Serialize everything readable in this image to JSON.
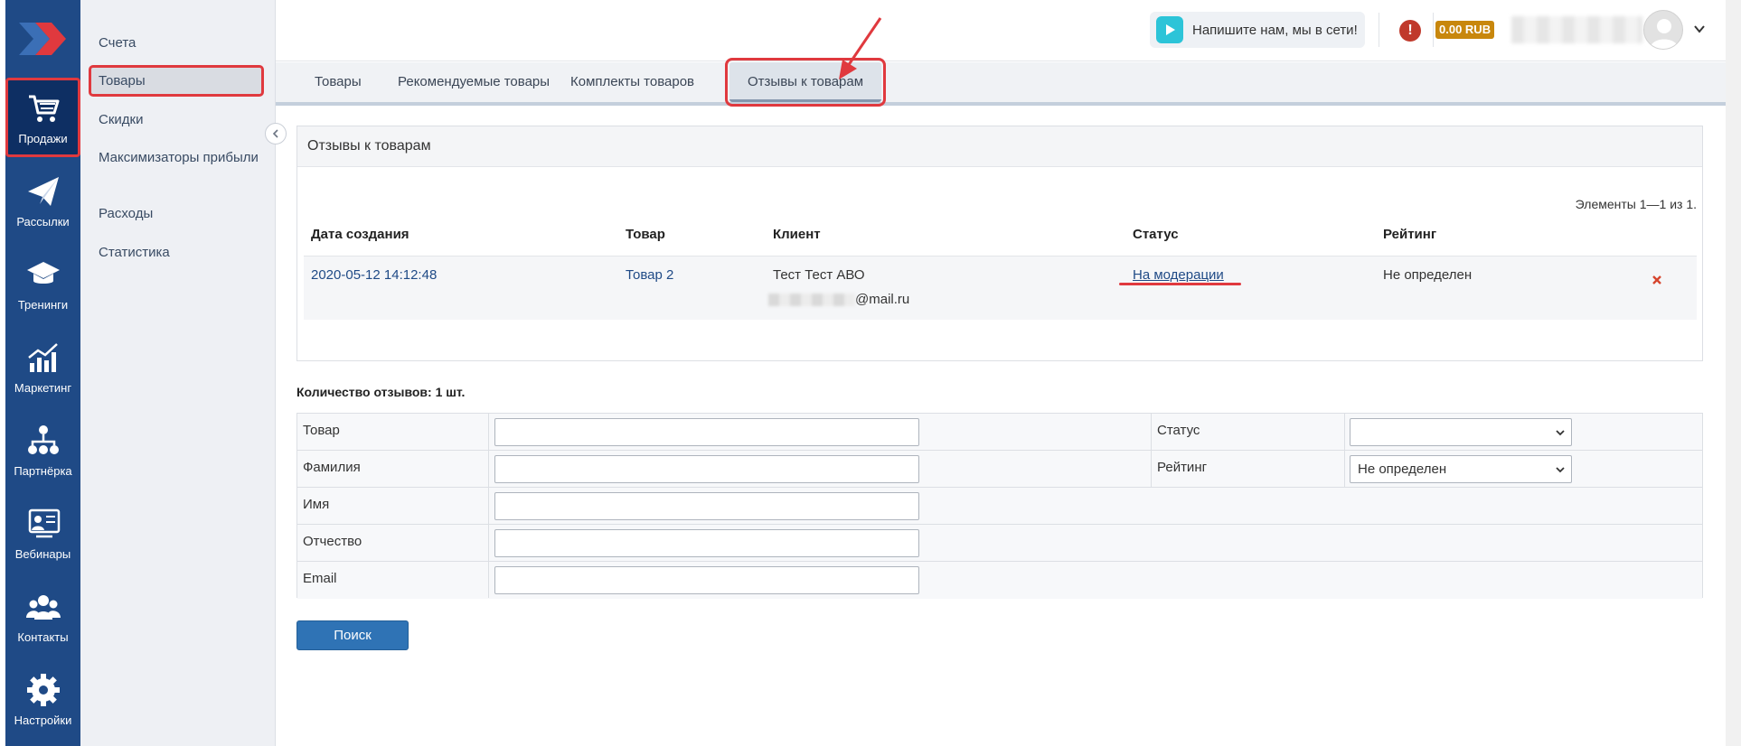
{
  "rail": {
    "items": [
      {
        "label": "Продажи",
        "icon": "cart-icon"
      },
      {
        "label": "Рассылки",
        "icon": "paper-plane-icon"
      },
      {
        "label": "Тренинги",
        "icon": "graduation-cap-icon"
      },
      {
        "label": "Маркетинг",
        "icon": "chart-bars-icon"
      },
      {
        "label": "Партнёрка",
        "icon": "partner-network-icon"
      },
      {
        "label": "Вебинары",
        "icon": "webinar-icon"
      },
      {
        "label": "Контакты",
        "icon": "users-icon"
      },
      {
        "label": "Настройки",
        "icon": "gear-icon"
      }
    ]
  },
  "subnav": {
    "items": [
      {
        "label": "Счета"
      },
      {
        "label": "Товары"
      },
      {
        "label": "Скидки"
      },
      {
        "label": "Максимизаторы прибыли"
      },
      {
        "label": "Расходы"
      },
      {
        "label": "Статистика"
      }
    ]
  },
  "topbar": {
    "chat_label": "Напишите нам, мы в сети!",
    "alert_label": "!",
    "balance": "0.00 RUB"
  },
  "tabs": [
    {
      "label": "Товары"
    },
    {
      "label": "Рекомендуемые товары"
    },
    {
      "label": "Комплекты товаров"
    },
    {
      "label": "Отзывы к товарам"
    }
  ],
  "panel": {
    "title": "Отзывы к товарам",
    "summary": "Элементы 1—1 из 1.",
    "columns": [
      "Дата создания",
      "Товар",
      "Клиент",
      "Статус",
      "Рейтинг"
    ],
    "rows": [
      {
        "date": "2020-05-12 14:12:48",
        "product": "Товар 2",
        "client_name": "Тест Тест АВО",
        "client_email_suffix": "@mail.ru",
        "status": "На модерации",
        "rating": "Не определен"
      }
    ]
  },
  "filter": {
    "count_label": "Количество отзывов: 1 шт.",
    "product_label": "Товар",
    "status_label": "Статус",
    "status_value": "",
    "lastname_label": "Фамилия",
    "rating_label": "Рейтинг",
    "rating_value": "Не определен",
    "firstname_label": "Имя",
    "patronymic_label": "Отчество",
    "email_label": "Email",
    "search_button": "Поиск"
  },
  "colors": {
    "rail_bg": "#1f4a86",
    "annotation_red": "#e0393e",
    "link_blue": "#1f4a86",
    "button_blue": "#2f73b5",
    "balance_gold": "#c8870d"
  }
}
